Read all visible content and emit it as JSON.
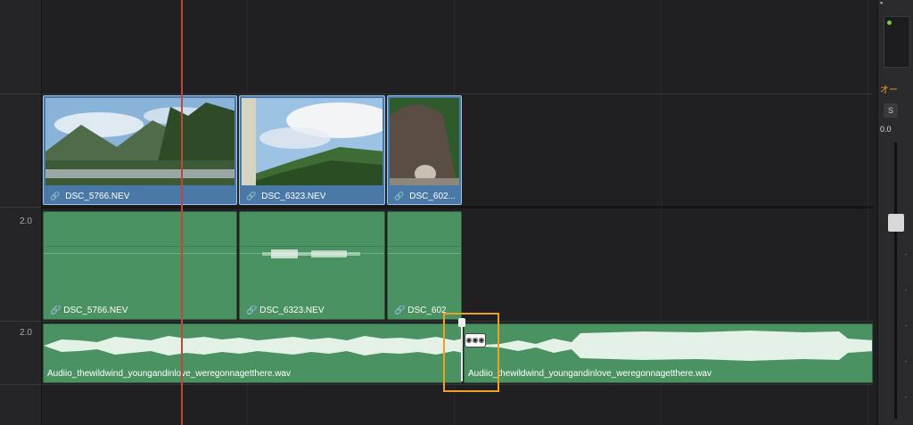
{
  "tracks": {
    "v1_level": "",
    "a1_level": "2.0",
    "a2_level": "2.0"
  },
  "video_clips": [
    {
      "name": "DSC_5766.NEV"
    },
    {
      "name": "DSC_6323.NEV"
    },
    {
      "name": "DSC_602..."
    }
  ],
  "audio_clips": [
    {
      "name": "DSC_5766.NEV"
    },
    {
      "name": "DSC_6323.NEV"
    },
    {
      "name": "DSC_602"
    }
  ],
  "music_clips": [
    {
      "name": "Audiio_thewildwind_youngandinlove_weregonnagetthere.wav"
    },
    {
      "name": "Audiio_thewildwind_youngandinlove_weregonnagetthere.wav"
    }
  ],
  "fade_badge": "◉◉◉",
  "mixer": {
    "panel_title": "オー",
    "solo_label": "S",
    "gain_value": "0.0"
  },
  "colors": {
    "video_clip": "#4a79a8",
    "audio_clip": "#4b9263",
    "playhead": "#c1473d",
    "highlight": "#f0a020"
  }
}
